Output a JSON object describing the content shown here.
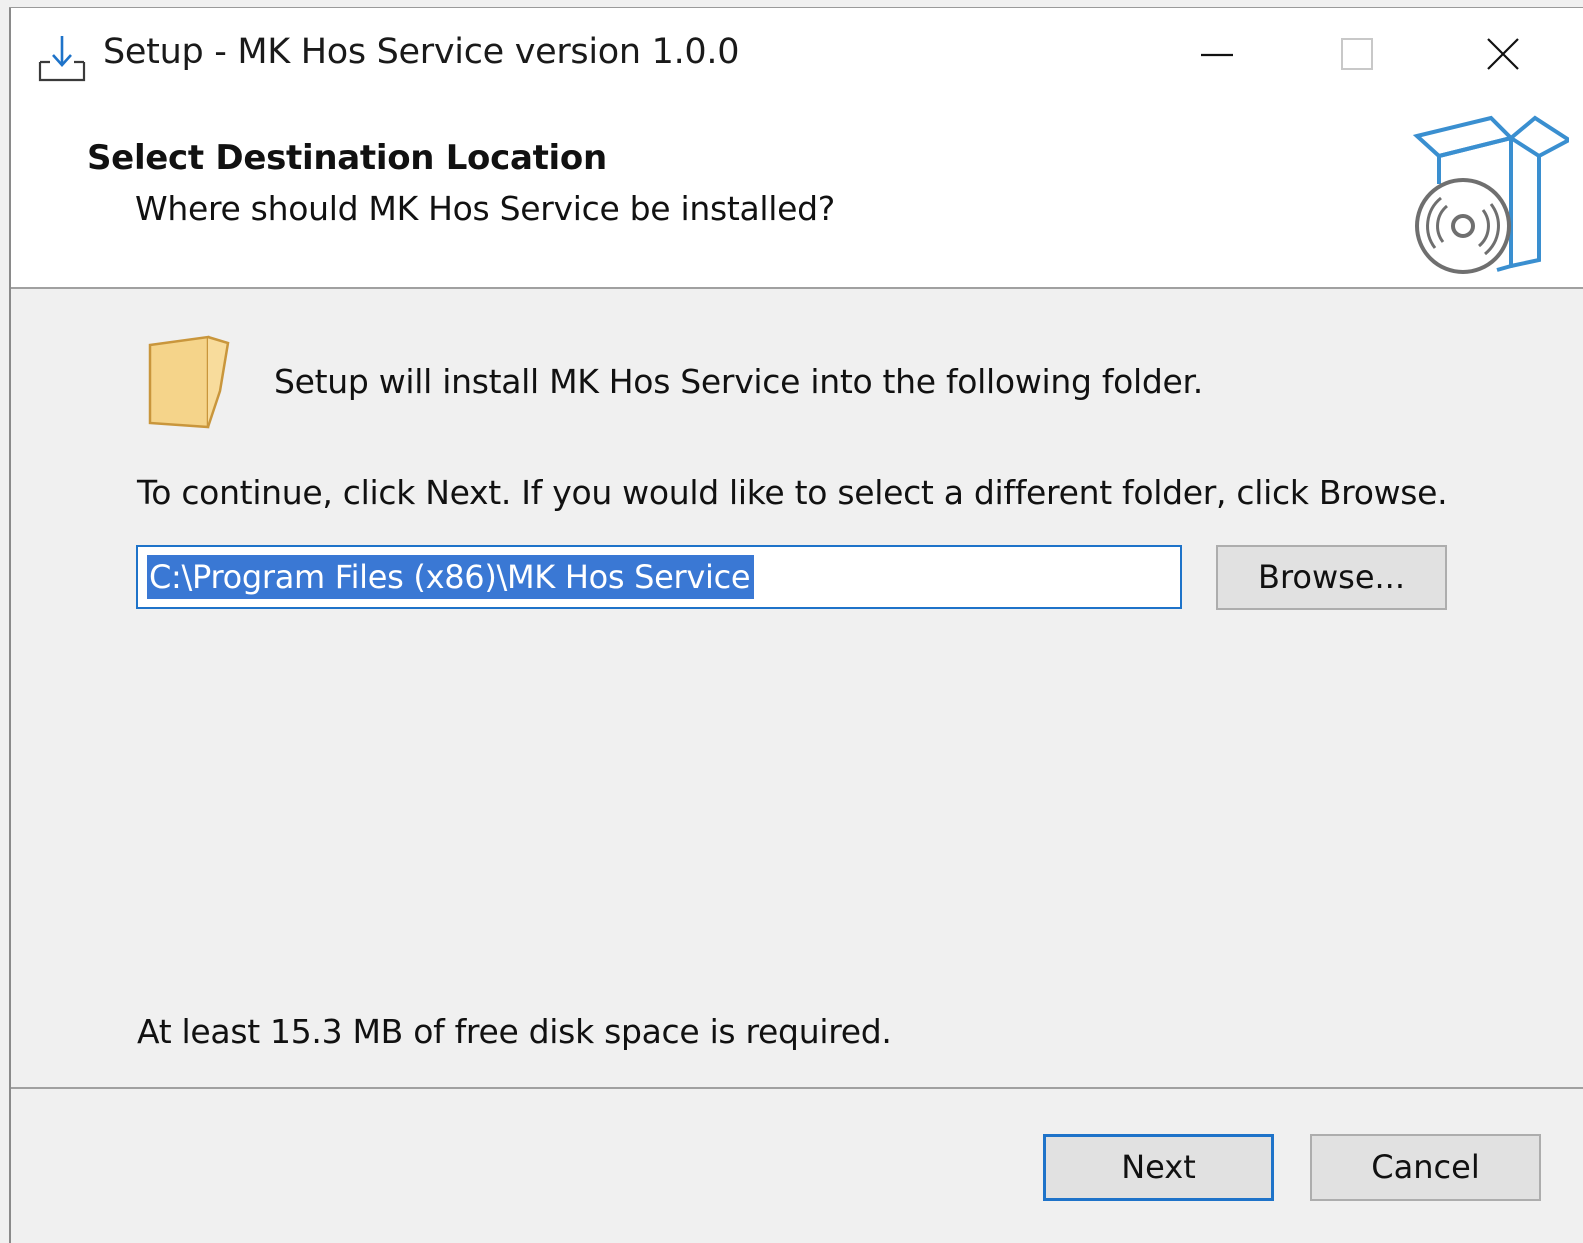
{
  "window": {
    "title": "Setup - MK Hos Service version 1.0.0",
    "controls": {
      "minimize_icon": "minimize-icon",
      "maximize_icon": "maximize-icon",
      "close_icon": "close-icon"
    }
  },
  "header": {
    "title": "Select Destination Location",
    "subtitle": "Where should MK Hos Service be installed?",
    "icon": "setup-box-disc-icon"
  },
  "body": {
    "intro": "Setup will install MK Hos Service into the following folder.",
    "instructions": "To continue, click Next. If you would like to select a different folder, click Browse.",
    "destination_path": "C:\\Program Files (x86)\\MK Hos Service",
    "browse_label": "Browse...",
    "disk_space": "At least 15.3 MB of free disk space is required."
  },
  "footer": {
    "next_label": "Next",
    "cancel_label": "Cancel"
  },
  "colors": {
    "accent": "#1e73c9",
    "selection": "#3a78d4",
    "folder": "#f5d48a",
    "wizard_icon": "#3a8fd0"
  }
}
